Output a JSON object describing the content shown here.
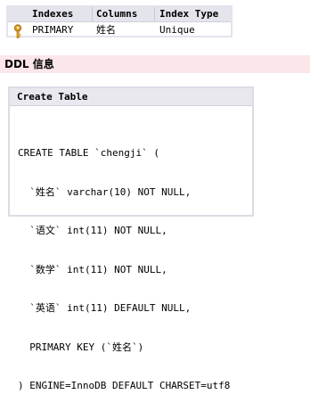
{
  "indexes_table": {
    "headers": [
      "Indexes",
      "Columns",
      "Index Type"
    ],
    "rows": [
      {
        "icon": "key-icon",
        "name": "PRIMARY",
        "columns": "姓名",
        "type": "Unique"
      }
    ]
  },
  "ddl_section": {
    "title": "DDL 信息"
  },
  "create_table_panel": {
    "header": "Create Table",
    "code_lines": [
      "CREATE TABLE `chengji` (",
      "  `姓名` varchar(10) NOT NULL,",
      "  `语文` int(11) NOT NULL,",
      "  `数学` int(11) NOT NULL,",
      "  `英语` int(11) DEFAULT NULL,",
      "  PRIMARY KEY (`姓名`)",
      ") ENGINE=InnoDB DEFAULT CHARSET=utf8"
    ]
  },
  "colors": {
    "header_bg": "#e4e4ec",
    "ddl_bar_bg": "#fbe6ea",
    "key_icon": "#e0a020"
  }
}
